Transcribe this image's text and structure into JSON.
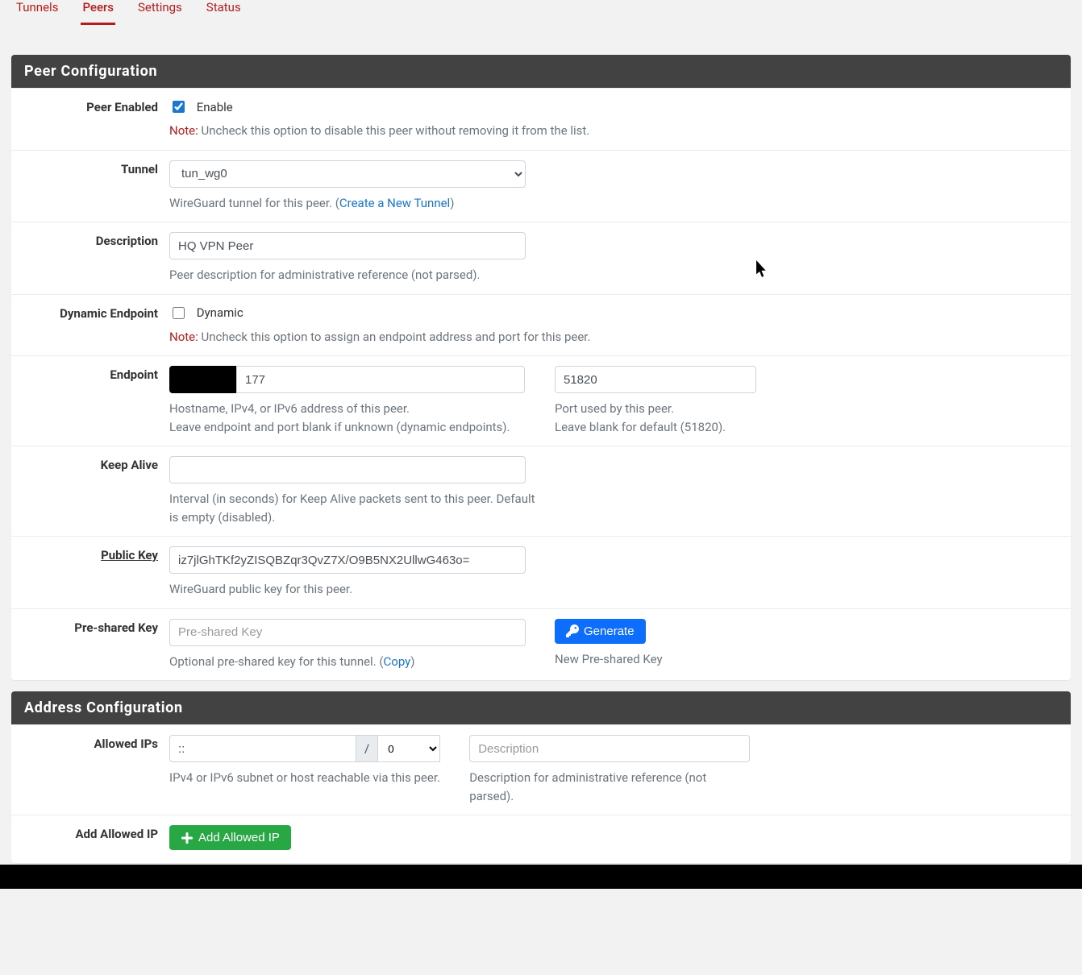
{
  "tabs": {
    "t0": "Tunnels",
    "t1": "Peers",
    "t2": "Settings",
    "t3": "Status"
  },
  "panel1": {
    "title": "Peer Configuration"
  },
  "enable": {
    "label": "Peer Enabled",
    "cb": "Enable",
    "note": "Note:",
    "note_text": " Uncheck this option to disable this peer without removing it from the list."
  },
  "tunnel": {
    "label": "Tunnel",
    "value": "tun_wg0",
    "help": "WireGuard tunnel for this peer. (",
    "link": "Create a New Tunnel",
    "help2": ")"
  },
  "desc": {
    "label": "Description",
    "value": "HQ VPN Peer",
    "help": "Peer description for administrative reference (not parsed)."
  },
  "dyn": {
    "label": "Dynamic Endpoint",
    "cb": "Dynamic",
    "note": "Note:",
    "note_text": " Uncheck this option to assign an endpoint address and port for this peer."
  },
  "endpoint": {
    "label": "Endpoint",
    "host_value": "177",
    "host_help": "Hostname, IPv4, or IPv6 address of this peer.\nLeave endpoint and port blank if unknown (dynamic endpoints).",
    "port_value": "51820",
    "port_help": "Port used by this peer.\nLeave blank for default (51820)."
  },
  "keepalive": {
    "label": "Keep Alive",
    "value": "",
    "help": "Interval (in seconds) for Keep Alive packets sent to this peer. Default is empty (disabled)."
  },
  "pubkey": {
    "label": "Public Key",
    "value": "iz7jlGhTKf2yZISQBZqr3QvZ7X/O9B5NX2UllwG463o=",
    "help": "WireGuard public key for this peer."
  },
  "psk": {
    "label": "Pre-shared Key",
    "placeholder": "Pre-shared Key",
    "help": "Optional pre-shared key for this tunnel. (",
    "copy": "Copy",
    "help2": ")",
    "btn": "Generate",
    "btn_help": "New Pre-shared Key"
  },
  "panel2": {
    "title": "Address Configuration"
  },
  "allowed": {
    "label": "Allowed IPs",
    "ip": "::",
    "mask": "0",
    "help": "IPv4 or IPv6 subnet or host reachable via this peer.",
    "desc_ph": "Description",
    "desc_help": "Description for administrative reference (not parsed)."
  },
  "addip": {
    "label": "Add Allowed IP",
    "btn": "Add Allowed IP"
  }
}
